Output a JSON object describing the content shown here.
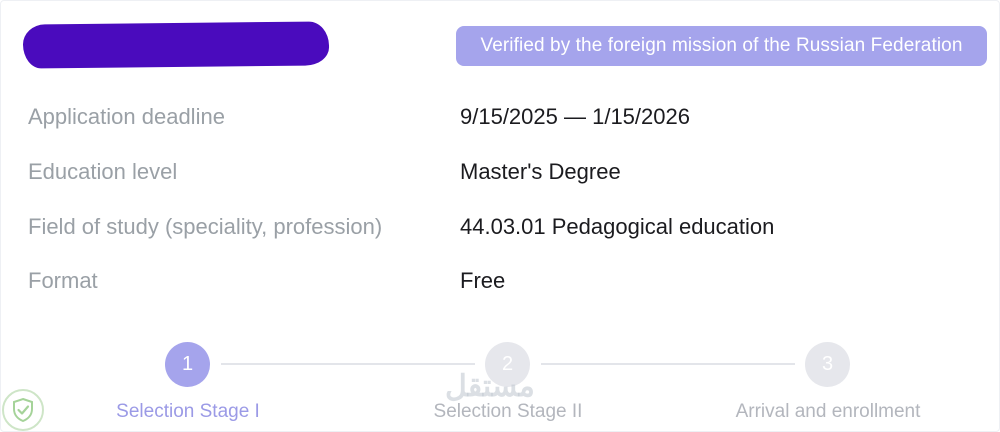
{
  "header": {
    "redacted_name": "",
    "verified_badge": "Verified by the foreign mission of the Russian Federation"
  },
  "details": [
    {
      "label": "Application deadline",
      "value": "9/15/2025 — 1/15/2026"
    },
    {
      "label": "Education level",
      "value": "Master's Degree"
    },
    {
      "label": "Field of study (speciality, profession)",
      "value": "44.03.01 Pedagogical education"
    },
    {
      "label": "Format",
      "value": "Free"
    }
  ],
  "stepper": {
    "steps": [
      {
        "number": "1",
        "label": "Selection Stage I",
        "state": "active"
      },
      {
        "number": "2",
        "label": "Selection Stage II",
        "state": "inactive"
      },
      {
        "number": "3",
        "label": "Arrival and enrollment",
        "state": "inactive"
      }
    ]
  },
  "watermark": {
    "text": "مستقل",
    "logo_icon": "shield-check-icon"
  },
  "colors": {
    "accent": "#a5a4ec",
    "redaction": "#4a0bbd",
    "label": "#9aa0a6",
    "value": "#1b1b1f",
    "inactive": "#e6e7ec"
  }
}
